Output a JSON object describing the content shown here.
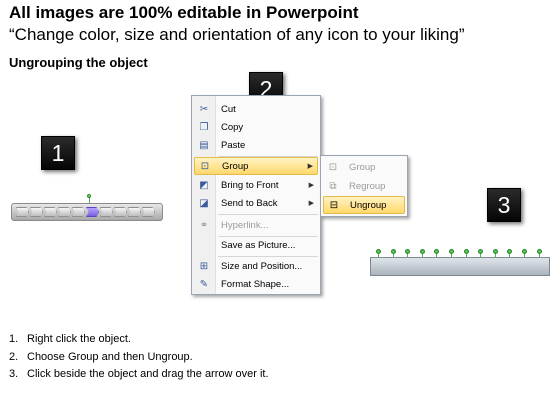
{
  "header": {
    "title": "All images are 100% editable in Powerpoint",
    "subtitle": "“Change color, size and orientation of any icon to your liking”",
    "section": "Ungrouping the object"
  },
  "badges": [
    "1",
    "2",
    "3"
  ],
  "context_menu": {
    "items": [
      {
        "label": "Cut",
        "icon": "cut-icon"
      },
      {
        "label": "Copy",
        "icon": "copy-icon"
      },
      {
        "label": "Paste",
        "icon": "paste-icon"
      },
      {
        "label": "Group",
        "icon": "group-icon",
        "highlighted": true,
        "submenu": true
      },
      {
        "label": "Bring to Front",
        "icon": "bring-to-front-icon",
        "submenu": true
      },
      {
        "label": "Send to Back",
        "icon": "send-to-back-icon",
        "submenu": true
      },
      {
        "label": "Hyperlink...",
        "icon": "hyperlink-icon",
        "disabled": true
      },
      {
        "label": "Save as Picture...",
        "icon": ""
      },
      {
        "label": "Size and Position...",
        "icon": "size-position-icon"
      },
      {
        "label": "Format Shape...",
        "icon": "format-shape-icon"
      }
    ]
  },
  "submenu": {
    "items": [
      {
        "label": "Group",
        "icon": "group-icon",
        "disabled": true
      },
      {
        "label": "Regroup",
        "icon": "regroup-icon",
        "disabled": true
      },
      {
        "label": "Ungroup",
        "icon": "ungroup-icon",
        "highlighted": true
      }
    ]
  },
  "steps": [
    {
      "num": "1.",
      "text": "Right click the object."
    },
    {
      "num": "2.",
      "text": "Choose Group and then Ungroup."
    },
    {
      "num": "3.",
      "text": "Click beside the object and drag the arrow over it."
    }
  ],
  "colors": {
    "highlight": "#ffd86b",
    "selected_segment": "#7a5fe0",
    "handle": "#52c452",
    "badge": "#111111"
  }
}
